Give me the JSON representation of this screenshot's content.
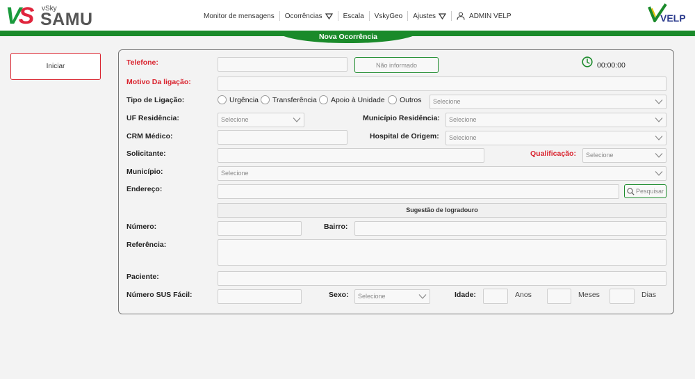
{
  "header": {
    "logo": {
      "mark_v": "V",
      "mark_s": "S",
      "vsky": "vSky",
      "samu": "SAMU"
    },
    "nav": {
      "monitor": "Monitor de mensagens",
      "ocorrencias": "Ocorrências",
      "escala": "Escala",
      "vskygeo": "VskyGeo",
      "ajustes": "Ajustes",
      "user": "ADMIN VELP"
    },
    "brand_right": "VELP",
    "tab_title": "Nova Ocorrência"
  },
  "sidebar": {
    "start_label": "Iniciar"
  },
  "form": {
    "telefone_label": "Telefone:",
    "nao_informado": "Não informado",
    "timer": "00:00:00",
    "motivo_label": "Motivo Da ligação:",
    "tipo_label": "Tipo de Ligação:",
    "tipo_options": [
      "Urgência",
      "Transferência",
      "Apoio à Unidade",
      "Outros"
    ],
    "select_placeholder": "Selecione",
    "uf_label": "UF Residência:",
    "municipio_res_label": "Município Residência:",
    "crm_label": "CRM Médico:",
    "hospital_label": "Hospital de Origem:",
    "solicitante_label": "Solicitante:",
    "qualificacao_label": "Qualificação:",
    "municipio_label": "Município:",
    "endereco_label": "Endereço:",
    "pesquisar": "Pesquisar",
    "sugestao": "Sugestão de logradouro",
    "numero_label": "Número:",
    "bairro_label": "Bairro:",
    "referencia_label": "Referência:",
    "paciente_label": "Paciente:",
    "sus_label": "Número SUS Fácil:",
    "sexo_label": "Sexo:",
    "idade_label": "Idade:",
    "anos": "Anos",
    "meses": "Meses",
    "dias": "Dias"
  },
  "colors": {
    "accent_green": "#1a8a2a",
    "alert_red": "#d9232e"
  }
}
